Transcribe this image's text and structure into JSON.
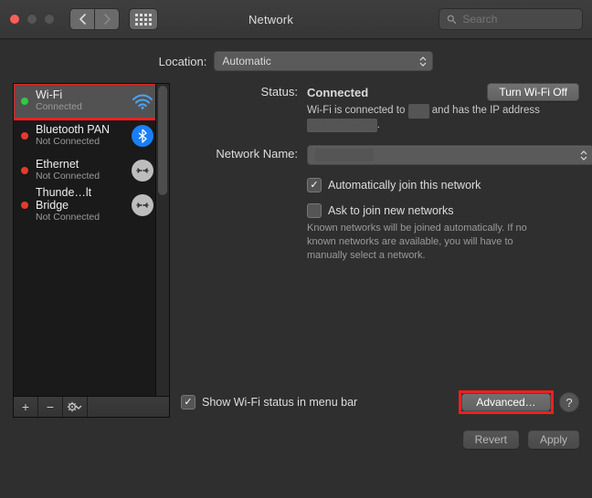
{
  "toolbar": {
    "title": "Network",
    "search_placeholder": "Search"
  },
  "location": {
    "label": "Location:",
    "value": "Automatic"
  },
  "sidebar": {
    "items": [
      {
        "name": "Wi-Fi",
        "status": "Connected",
        "dot": "green",
        "icon": "wifi",
        "selected": true
      },
      {
        "name": "Bluetooth PAN",
        "status": "Not Connected",
        "dot": "red",
        "icon": "bluetooth",
        "selected": false
      },
      {
        "name": "Ethernet",
        "status": "Not Connected",
        "dot": "red",
        "icon": "ethernet",
        "selected": false
      },
      {
        "name": "Thunde…lt Bridge",
        "status": "Not Connected",
        "dot": "red",
        "icon": "thunderbolt",
        "selected": false
      }
    ]
  },
  "detail": {
    "status_label": "Status:",
    "status_value": "Connected",
    "turn_off_label": "Turn Wi-Fi Off",
    "status_sub_a": "Wi-Fi is connected to ",
    "status_sub_b": " and has the IP address ",
    "status_sub_c": ".",
    "network_name_label": "Network Name:",
    "network_name_value": "",
    "auto_join": "Automatically join this network",
    "ask_join": "Ask to join new networks",
    "ask_join_hint": "Known networks will be joined automatically. If no known networks are available, you will have to manually select a network.",
    "show_menubar": "Show Wi-Fi status in menu bar",
    "advanced": "Advanced…",
    "help": "?"
  },
  "footer": {
    "revert": "Revert",
    "apply": "Apply"
  }
}
